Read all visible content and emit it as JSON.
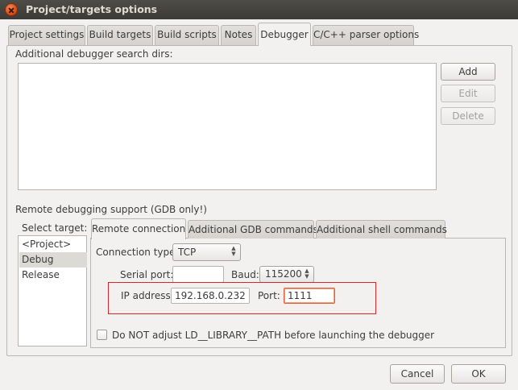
{
  "window": {
    "title": "Project/targets options"
  },
  "tabs": [
    {
      "label": "Project settings"
    },
    {
      "label": "Build targets"
    },
    {
      "label": "Build scripts"
    },
    {
      "label": "Notes"
    },
    {
      "label": "Debugger"
    },
    {
      "label": "C/C++ parser options"
    }
  ],
  "search_dirs": {
    "label": "Additional debugger search dirs:",
    "buttons": {
      "add": "Add",
      "edit": "Edit",
      "delete": "Delete"
    }
  },
  "remote": {
    "label": "Remote debugging support (GDB only!)",
    "select_target_label": "Select target:",
    "targets": [
      "<Project>",
      "Debug",
      "Release"
    ],
    "selected_target": "Debug",
    "subtabs": [
      {
        "label": "Remote connection"
      },
      {
        "label": "Additional GDB commands"
      },
      {
        "label": "Additional shell commands"
      }
    ],
    "connection_type_label": "Connection type:",
    "connection_type_value": "TCP",
    "serial_port_label": "Serial port:",
    "serial_port_value": "",
    "baud_label": "Baud:",
    "baud_value": "115200",
    "ip_label": "IP address:",
    "ip_value": "192.168.0.232",
    "port_label": "Port:",
    "port_value": "1111",
    "ld_checkbox_label": "Do NOT adjust LD__LIBRARY__PATH before launching the debugger",
    "ld_checkbox_checked": false
  },
  "footer": {
    "cancel": "Cancel",
    "ok": "OK"
  },
  "colors": {
    "titlebar": "#3c3b37",
    "accent_close": "#d9450f",
    "annotation_box": "#d9262c",
    "focus_border": "#e0613a"
  }
}
